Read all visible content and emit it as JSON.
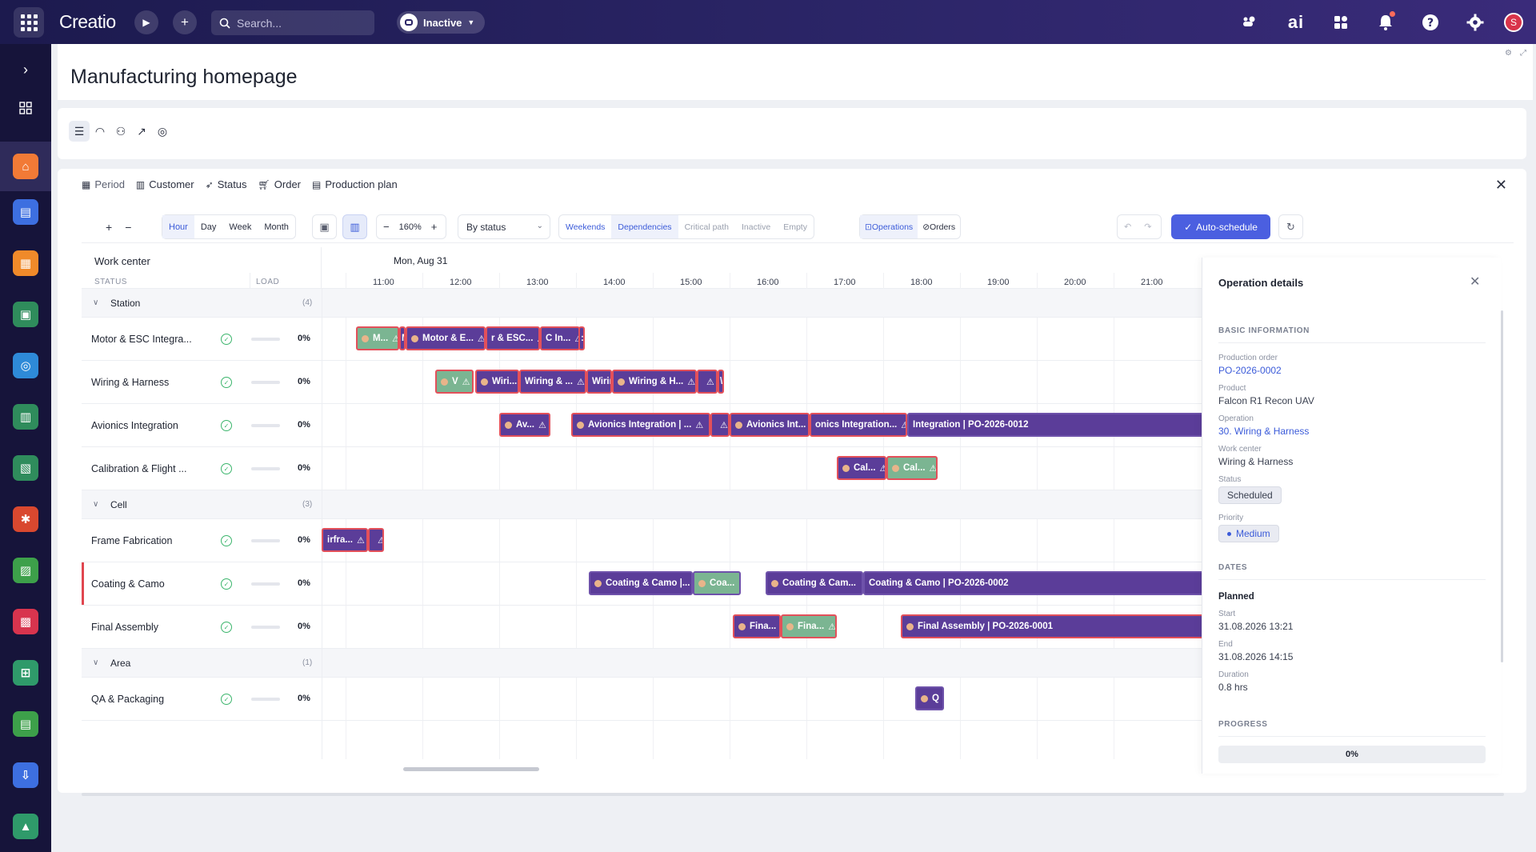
{
  "topbar": {
    "logo": "Creatio",
    "search_placeholder": "Search...",
    "status": "Inactive",
    "ai_label": "ai",
    "avatar_initial": "S"
  },
  "page": {
    "title": "Manufacturing homepage"
  },
  "filters": [
    "Period",
    "Customer",
    "Status",
    "Order",
    "Production plan"
  ],
  "toolbar": {
    "views": [
      "Hour",
      "Day",
      "Week",
      "Month"
    ],
    "active_view": "Hour",
    "zoom": "160%",
    "group_by": "By status",
    "toggles": [
      {
        "label": "Weekends",
        "on": true
      },
      {
        "label": "Dependencies",
        "on": true
      },
      {
        "label": "Critical path",
        "on": false
      },
      {
        "label": "Inactive",
        "on": false
      },
      {
        "label": "Empty",
        "on": false
      }
    ],
    "mode_operations": "Operations",
    "mode_orders": "Orders",
    "auto_schedule": "Auto-schedule"
  },
  "grid": {
    "work_center_header": "Work center",
    "status_header": "STATUS",
    "load_header": "LOAD",
    "date": "Mon, Aug 31",
    "hours": [
      "11:00",
      "12:00",
      "13:00",
      "14:00",
      "15:00",
      "16:00",
      "17:00",
      "18:00",
      "19:00",
      "20:00",
      "21:00"
    ],
    "groups": [
      {
        "name": "Station",
        "count": "(4)"
      },
      {
        "name": "Cell",
        "count": "(3)"
      },
      {
        "name": "Area",
        "count": "(1)"
      }
    ],
    "rows": [
      {
        "name": "Motor & ESC Integra...",
        "load": "0%"
      },
      {
        "name": "Wiring & Harness",
        "load": "0%"
      },
      {
        "name": "Avionics Integration",
        "load": "0%"
      },
      {
        "name": "Calibration & Flight ...",
        "load": "0%"
      },
      {
        "name": "Frame Fabrication",
        "load": "0%"
      },
      {
        "name": "Coating & Camo",
        "load": "0%"
      },
      {
        "name": "Final Assembly",
        "load": "0%"
      },
      {
        "name": "QA & Packaging",
        "load": "0%"
      }
    ],
    "bars": {
      "motor": [
        "M...",
        "M",
        "Motor & E...",
        "r & ESC...",
        "C In...",
        ":"
      ],
      "wiring": [
        "V",
        "Wiri...",
        "Wiring & ...",
        "Wirir",
        "Wiring & H...",
        "",
        "\\"
      ],
      "avionics": [
        "Av...",
        "Avionics Integration | ...",
        "",
        "Avionics Int...",
        "onics Integration...",
        "Integration | PO-2026-0012"
      ],
      "calibration": [
        "Cal...",
        "Cal..."
      ],
      "frame": [
        "irfra...",
        ""
      ],
      "coating": [
        "Coating & Camo |...",
        "Coa...",
        "Coating & Cam...",
        "Coating & Camo | PO-2026-0002"
      ],
      "final": [
        "Fina...",
        "Fina...",
        "Final Assembly | PO-2026-0001"
      ],
      "qa": [
        "Q"
      ]
    }
  },
  "details": {
    "title": "Operation details",
    "basic_info": "BASIC INFORMATION",
    "production_order_label": "Production order",
    "production_order": "PO-2026-0002",
    "product_label": "Product",
    "product": "Falcon R1 Recon UAV",
    "operation_label": "Operation",
    "operation": "30. Wiring & Harness",
    "work_center_label": "Work center",
    "work_center": "Wiring & Harness",
    "status_label": "Status",
    "status": "Scheduled",
    "priority_label": "Priority",
    "priority": "Medium",
    "dates": "DATES",
    "planned": "Planned",
    "start_label": "Start",
    "start": "31.08.2026 13:21",
    "end_label": "End",
    "end": "31.08.2026 14:15",
    "duration_label": "Duration",
    "duration": "0.8 hrs",
    "progress": "PROGRESS",
    "progress_value": "0%"
  },
  "colors": {
    "topbar": "#2b2567",
    "accent": "#4b5fe0",
    "bar_purple": "#5b3d99",
    "bar_green": "#7bb592",
    "bar_border": "#e3505a"
  }
}
